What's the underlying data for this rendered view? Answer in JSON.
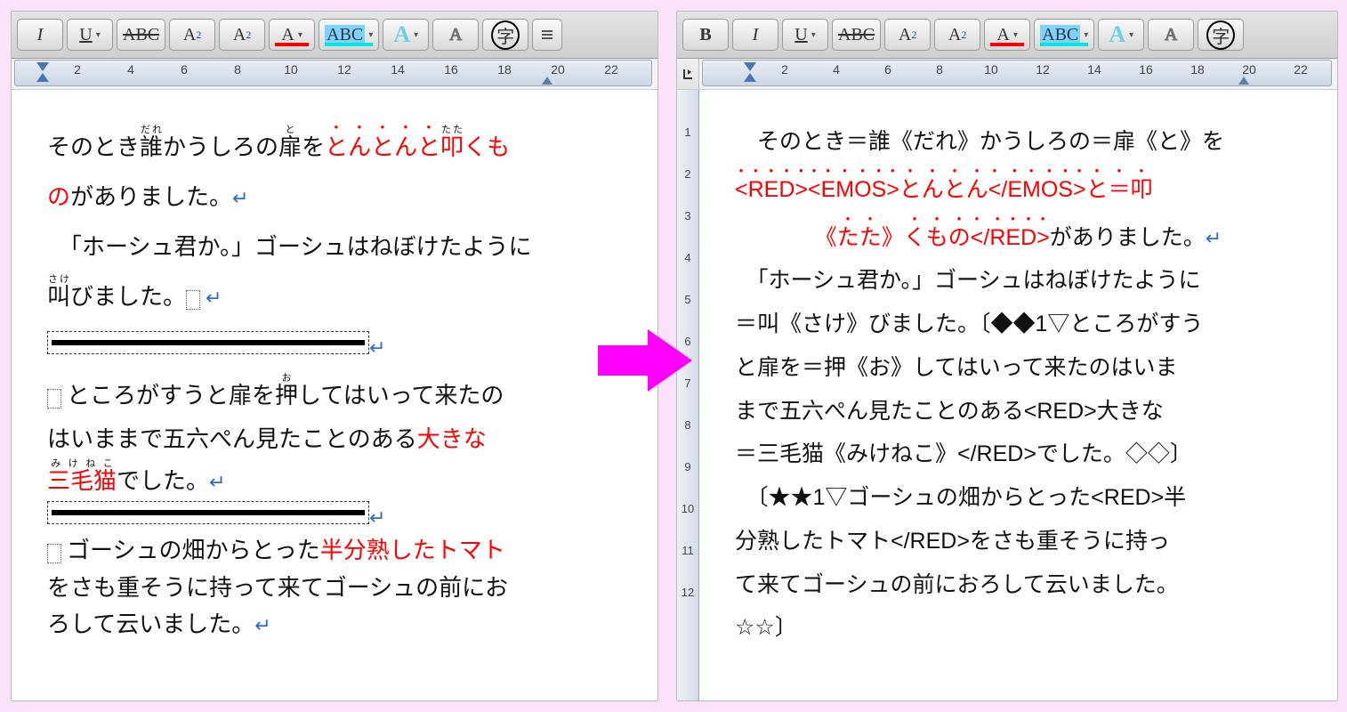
{
  "toolbar": {
    "bold": "B",
    "italic": "I",
    "underline": "U",
    "strike": "ABC",
    "superscript_base": "A",
    "subscript_base": "A",
    "fontcolor_base": "A",
    "highlight_base": "ABC",
    "bigA": "A",
    "shadowA": "A",
    "jichar": "字"
  },
  "ruler": {
    "ticks": [
      2,
      4,
      6,
      8,
      10,
      12,
      14,
      16,
      18,
      20,
      22
    ]
  },
  "vruler": {
    "ticks": [
      1,
      2,
      3,
      4,
      5,
      6,
      7,
      8,
      9,
      10,
      11,
      12
    ]
  },
  "left_doc": {
    "l1a": "そのとき",
    "l1_ruby1_base": "誰",
    "l1_ruby1_rt": "だれ",
    "l1b": "かうしろの",
    "l1_ruby2_base": "扉",
    "l1_ruby2_rt": "と",
    "l1c": "を",
    "l1_red": "とんとんと",
    "l1_ruby3_base": "叩",
    "l1_ruby3_rt": "たた",
    "l1d": "くも",
    "l2_red": "の",
    "l2b": "がありました。",
    "l3": "「ホーシュ君か。」ゴーシュはねぼけたように",
    "l4_ruby_base": "叫",
    "l4_ruby_rt": "さけ",
    "l4b": "びました。",
    "l5a": "ところがすうと扉を",
    "l5_ruby_base": "押",
    "l5_ruby_rt": "お",
    "l5b": "してはいって来たの",
    "l6a": "はいままで五六ぺん見たことのある",
    "l6_red": "大きな",
    "l7_ruby_base": "三毛猫",
    "l7_ruby_rt": "みけねこ",
    "l7_red_tail": "",
    "l7b": "でした。",
    "l8a": "ゴーシュの畑からとった",
    "l8_red": "半分熟したトマト",
    "l9": "をさも重そうに持って来てゴーシュの前にお",
    "l10": "ろして云いました。"
  },
  "right_doc": {
    "r1": "そのとき＝誰《だれ》かうしろの＝扉《と》を",
    "r2": "<RED><EMOS>とんとん</EMOS>と＝叩",
    "r3a": "《たた》くもの</RED>",
    "r3b": "がありました。",
    "r4": "「ホーシュ君か。」ゴーシュはねぼけたように",
    "r5": "＝叫《さけ》びました。〔◆◆1▽ところがすう",
    "r6": "と扉を＝押《お》してはいって来たのはいま",
    "r7": "まで五六ぺん見たことのある<RED>大きな",
    "r8": "＝三毛猫《みけねこ》</RED>でした。◇◇〕",
    "r9": "〔★★1▽ゴーシュの畑からとった<RED>半",
    "r10": "分熟したトマト</RED>をさも重そうに持っ",
    "r11": "て来てゴーシュの前におろして云いました。",
    "r12": "☆☆〕"
  },
  "pmark": "↵"
}
